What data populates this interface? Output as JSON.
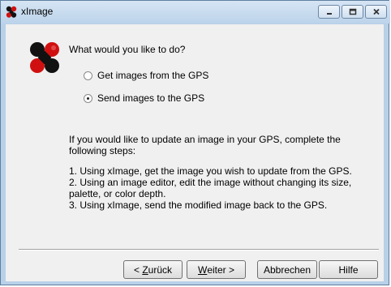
{
  "window": {
    "title": "xImage"
  },
  "titlebar": {
    "minimize": "minimize",
    "maximize": "maximize",
    "close": "close"
  },
  "main": {
    "question": "What would you like to do?",
    "options": [
      {
        "label": "Get images from the GPS",
        "checked": false
      },
      {
        "label": "Send images to the GPS",
        "checked": true
      }
    ],
    "info": "If you would like to update an image in your GPS, complete the following steps:",
    "steps": [
      "1. Using xImage, get the image you wish to update from the GPS.",
      "2. Using an image editor, edit the image without changing its size, palette, or color depth.",
      "3. Using xImage, send the modified image back to the GPS."
    ]
  },
  "buttons": {
    "back_prefix": "< ",
    "back_mnemonic": "Z",
    "back_rest": "urück",
    "next_mnemonic": "W",
    "next_rest": "eiter >",
    "cancel": "Abbrechen",
    "help": "Hilfe"
  }
}
